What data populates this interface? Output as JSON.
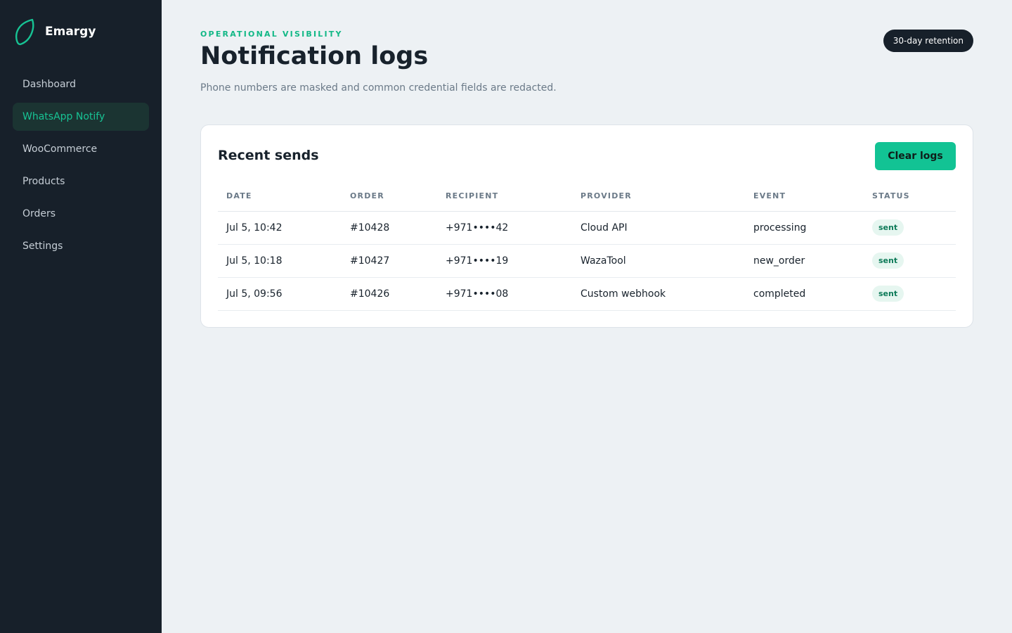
{
  "brand": {
    "name": "Emargy"
  },
  "nav": {
    "items": [
      {
        "label": "Dashboard",
        "active": false
      },
      {
        "label": "WhatsApp Notify",
        "active": true
      },
      {
        "label": "WooCommerce",
        "active": false
      },
      {
        "label": "Products",
        "active": false
      },
      {
        "label": "Orders",
        "active": false
      },
      {
        "label": "Settings",
        "active": false
      }
    ]
  },
  "header": {
    "eyebrow": "OPERATIONAL VISIBILITY",
    "title": "Notification logs",
    "subtitle": "Phone numbers are masked and common credential fields are redacted.",
    "retention_badge": "30-day retention"
  },
  "card": {
    "title": "Recent sends",
    "clear_button": "Clear logs",
    "columns": [
      "DATE",
      "ORDER",
      "RECIPIENT",
      "PROVIDER",
      "EVENT",
      "STATUS"
    ],
    "rows": [
      {
        "date": "Jul 5, 10:42",
        "order": "#10428",
        "recipient": "+971••••42",
        "provider": "Cloud API",
        "event": "processing",
        "status": "sent"
      },
      {
        "date": "Jul 5, 10:18",
        "order": "#10427",
        "recipient": "+971••••19",
        "provider": "WazaTool",
        "event": "new_order",
        "status": "sent"
      },
      {
        "date": "Jul 5, 09:56",
        "order": "#10426",
        "recipient": "+971••••08",
        "provider": "Custom webhook",
        "event": "completed",
        "status": "sent"
      }
    ]
  },
  "colors": {
    "accent": "#12c394",
    "sidebar_bg": "#17202a",
    "page_bg": "#edf1f4",
    "status_sent_bg": "#e6f6f0",
    "status_sent_text": "#0d7a58"
  }
}
